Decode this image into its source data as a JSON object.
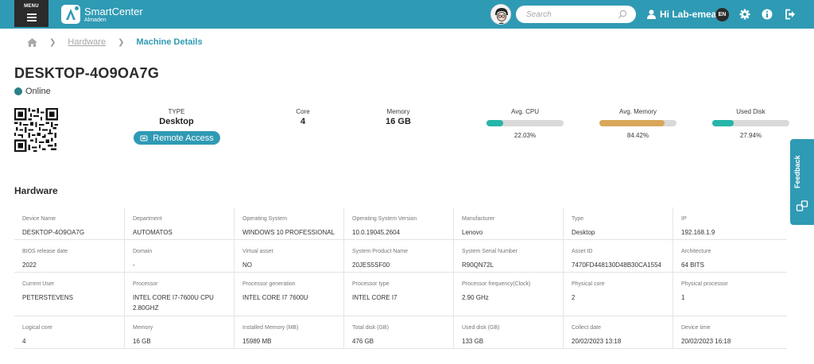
{
  "header": {
    "menu_label": "MENU",
    "brand_name": "SmartCenter",
    "brand_sub": "Almaden",
    "search_placeholder": "Search",
    "greeting": "Hi Lab-emea",
    "language": "EN",
    "accent_color": "#2f9ab4"
  },
  "breadcrumb": {
    "items": [
      "Hardware"
    ],
    "current": "Machine Details"
  },
  "machine": {
    "name": "DESKTOP-4O9OA7G",
    "status": "Online",
    "status_color": "#2a7f88",
    "type_label": "TYPE",
    "type_value": "Desktop",
    "core_label": "Core",
    "core_value": "4",
    "memory_label": "Memory",
    "memory_value": "16 GB",
    "remote_label": "Remote Access"
  },
  "gauges": [
    {
      "label": "Avg. CPU",
      "value_text": "22.03%",
      "fraction": 0.2203,
      "color": "#26b5a8"
    },
    {
      "label": "Avg. Memory",
      "value_text": "84.42%",
      "fraction": 0.8442,
      "color": "#d9a75a"
    },
    {
      "label": "Used Disk",
      "value_text": "27.94%",
      "fraction": 0.2794,
      "color": "#26b5a8"
    }
  ],
  "feedback_label": "Feedback",
  "hardware": {
    "title": "Hardware",
    "rows": [
      [
        {
          "label": "Device Name",
          "value": "DESKTOP-4O9OA7G"
        },
        {
          "label": "Department",
          "value": "AUTOMATOS"
        },
        {
          "label": "Operating System",
          "value": "WINDOWS 10 PROFESSIONAL"
        },
        {
          "label": "Operating System Version",
          "value": "10.0.19045.2604"
        },
        {
          "label": "Manufacturer",
          "value": "Lenovo"
        },
        {
          "label": "Type",
          "value": "Desktop"
        },
        {
          "label": "IP",
          "value": "192.168.1.9"
        }
      ],
      [
        {
          "label": "BIOS release date",
          "value": "2022"
        },
        {
          "label": "Domain",
          "value": "-"
        },
        {
          "label": "Virtual asset",
          "value": "NO"
        },
        {
          "label": "System Product Name",
          "value": "20JES5SF00"
        },
        {
          "label": "System Serial Number",
          "value": "R90QN72L"
        },
        {
          "label": "Asset ID",
          "value": "7470FD448130D48B30CA1554"
        },
        {
          "label": "Architecture",
          "value": "64 BITS"
        }
      ],
      [
        {
          "label": "Current User",
          "value": "PETERSTEVENS"
        },
        {
          "label": "Processor",
          "value": "INTEL CORE I7-7600U CPU 2.80GHZ"
        },
        {
          "label": "Processor generation",
          "value": "INTEL CORE I7 7600U"
        },
        {
          "label": "Processor type",
          "value": "INTEL CORE I7"
        },
        {
          "label": "Processor frequency(Clock)",
          "value": "2.90 GHz"
        },
        {
          "label": "Physical core",
          "value": "2"
        },
        {
          "label": "Physical processor",
          "value": "1"
        }
      ],
      [
        {
          "label": "Logical core",
          "value": "4"
        },
        {
          "label": "Memory",
          "value": "16 GB"
        },
        {
          "label": "Installed Memory (MB)",
          "value": "15989 MB"
        },
        {
          "label": "Total disk (GB)",
          "value": "476 GB"
        },
        {
          "label": "Used disk (GB)",
          "value": "133 GB"
        },
        {
          "label": "Collect date",
          "value": "20/02/2023 13:18"
        },
        {
          "label": "Device time",
          "value": "20/02/2023 16:18"
        }
      ]
    ]
  }
}
